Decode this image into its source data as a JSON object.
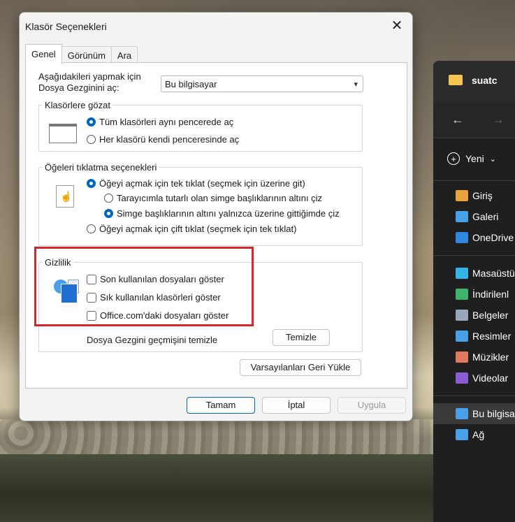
{
  "dialog": {
    "title": "Klasör Seçenekleri",
    "close_glyph": "✕",
    "tabs": [
      "Genel",
      "Görünüm",
      "Ara"
    ],
    "open_label": "Aşağıdakileri yapmak için Dosya Gezginini aç:",
    "open_select_value": "Bu bilgisayar",
    "browse": {
      "legend": "Klasörlere gözat",
      "option_same": "Tüm klasörleri aynı pencerede aç",
      "option_own": "Her klasörü kendi penceresinde aç",
      "selected": "same"
    },
    "click": {
      "legend": "Öğeleri tıklatma seçenekleri",
      "single": "Öğeyi açmak için tek tıklat (seçmek için üzerine git)",
      "underline_browser": "Tarayıcımla tutarlı olan simge başlıklarının altını çiz",
      "underline_hover": "Simge başlıklarının altını yalnızca üzerine gittiğimde çiz",
      "double": "Öğeyi açmak için çift tıklat (seçmek için tek tıklat)",
      "selected": "single",
      "underline_selected": "hover"
    },
    "privacy": {
      "legend": "Gizlilik",
      "recent_files": "Son kullanılan dosyaları göster",
      "frequent_folders": "Sık kullanılan klasörleri göster",
      "office_files": "Office.com'daki dosyaları göster",
      "clear_label": "Dosya Gezgini geçmişini temizle",
      "clear_button": "Temizle"
    },
    "restore_defaults": "Varsayılanları Geri Yükle",
    "ok": "Tamam",
    "cancel": "İptal",
    "apply": "Uygula"
  },
  "explorer": {
    "title": "suatc",
    "back_glyph": "←",
    "forward_glyph": "→",
    "new_label": "Yeni",
    "new_chevron": "⌄",
    "nav_items": [
      {
        "label": "Giriş",
        "icon": "home-icon",
        "color": "#e8a33d"
      },
      {
        "label": "Galeri",
        "icon": "gallery-icon",
        "color": "#4aa0e6"
      },
      {
        "label": "OneDrive",
        "icon": "cloud-icon",
        "color": "#2f88e0"
      }
    ],
    "library_items": [
      {
        "label": "Masaüstü",
        "icon": "desktop-icon",
        "color": "#34b5e8"
      },
      {
        "label": "İndirilenl",
        "icon": "download-icon",
        "color": "#3db36b"
      },
      {
        "label": "Belgeler",
        "icon": "documents-icon",
        "color": "#9aa7b8"
      },
      {
        "label": "Resimler",
        "icon": "pictures-icon",
        "color": "#4aa0e6"
      },
      {
        "label": "Müzikler",
        "icon": "music-icon",
        "color": "#e07a5f"
      },
      {
        "label": "Videolar",
        "icon": "videos-icon",
        "color": "#8a5cd1"
      }
    ],
    "pc_items": [
      {
        "label": "Bu bilgisa",
        "icon": "computer-icon",
        "color": "#4aa0e6"
      },
      {
        "label": "Ağ",
        "icon": "network-icon",
        "color": "#4aa0e6"
      }
    ],
    "folder_color": "#f5c451"
  },
  "highlight_color": "#d9252c"
}
